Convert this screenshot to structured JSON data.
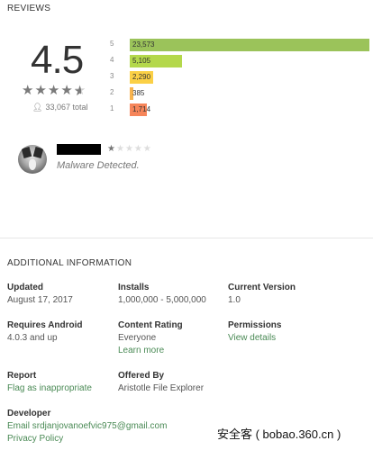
{
  "reviews": {
    "title": "REVIEWS",
    "score": "4.5",
    "total": "33,067 total",
    "histogram": [
      {
        "stars": "5",
        "count": "23,573",
        "fraction": 1.0,
        "color": "#9bc35a"
      },
      {
        "stars": "4",
        "count": "5,105",
        "fraction": 0.217,
        "color": "#b4d84b"
      },
      {
        "stars": "3",
        "count": "2,290",
        "fraction": 0.097,
        "color": "#fbd046"
      },
      {
        "stars": "2",
        "count": "385",
        "fraction": 0.016,
        "color": "#f9b44f"
      },
      {
        "stars": "1",
        "count": "1,714",
        "fraction": 0.073,
        "color": "#f6855a"
      }
    ],
    "review": {
      "rating": 1,
      "text": "Malware Detected."
    }
  },
  "additional_info": {
    "title": "ADDITIONAL INFORMATION",
    "updated": {
      "label": "Updated",
      "value": "August 17, 2017"
    },
    "installs": {
      "label": "Installs",
      "value": "1,000,000 - 5,000,000"
    },
    "current_version": {
      "label": "Current Version",
      "value": "1.0"
    },
    "requires_android": {
      "label": "Requires Android",
      "value": "4.0.3 and up"
    },
    "content_rating": {
      "label": "Content Rating",
      "value": "Everyone",
      "link": "Learn more"
    },
    "permissions": {
      "label": "Permissions",
      "link": "View details"
    },
    "report": {
      "label": "Report",
      "link": "Flag as inappropriate"
    },
    "offered_by": {
      "label": "Offered By",
      "value": "Aristotle File Explorer"
    },
    "developer": {
      "label": "Developer",
      "email": "Email srdjanjovanoefvic975@gmail.com",
      "privacy": "Privacy Policy"
    }
  },
  "watermark": "安全客 ( bobao.360.cn )"
}
